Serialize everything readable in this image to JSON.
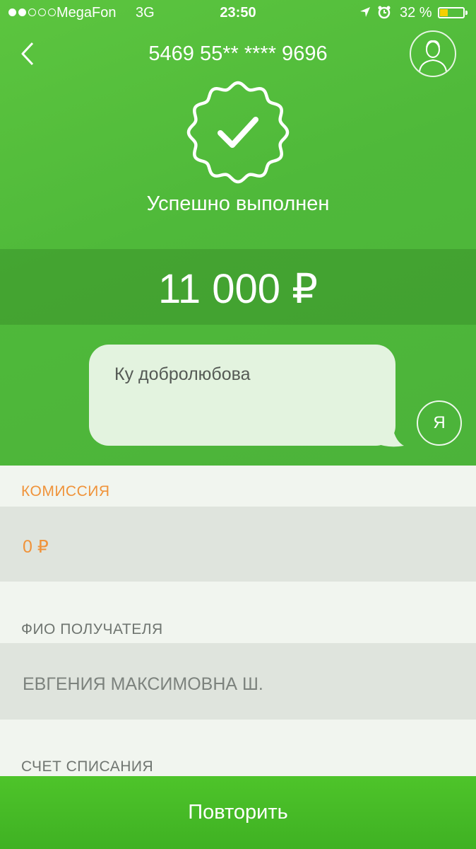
{
  "status_bar": {
    "carrier": "MegaFon",
    "network": "3G",
    "time": "23:50",
    "battery": "32 %",
    "battery_level": 0.32,
    "signal_strength_dots": 2,
    "signal_total_dots": 5
  },
  "header": {
    "card_number": "5469 55** **** 9696",
    "back_icon": "chevron-left-icon",
    "profile_icon": "user-icon"
  },
  "result": {
    "status": "Успешно выполнен",
    "icon": "check-badge-icon",
    "amount": "11 000 ₽"
  },
  "message": {
    "text": "Ку добролюбова",
    "sender_avatar": "Я"
  },
  "details": {
    "commission_label": "КОМИССИЯ",
    "commission_value": "0 ₽",
    "recipient_label": "ФИО ПОЛУЧАТЕЛЯ",
    "recipient_value": "ЕВГЕНИЯ МАКСИМОВНА Ш.",
    "account_label": "СЧЕТ СПИСАНИЯ"
  },
  "actions": {
    "repeat_label": "Повторить"
  },
  "colors": {
    "brand_green": "#4fb93a",
    "button_green": "#46b926",
    "accent_orange": "#f0933a",
    "label_gray": "#6f7570",
    "value_gray": "#7c827d"
  }
}
